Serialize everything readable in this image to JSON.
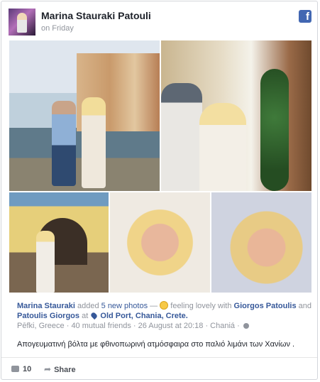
{
  "post": {
    "author": "Marina Stauraki Patouli",
    "timestamp": "on Friday",
    "brand_icon": "facebook-icon"
  },
  "photos": [
    {
      "name": "photo-harbor-couple"
    },
    {
      "name": "photo-street-selfie"
    },
    {
      "name": "photo-shop-doorway"
    },
    {
      "name": "photo-selfie-1"
    },
    {
      "name": "photo-selfie-2"
    }
  ],
  "caption": {
    "actor": "Marina Stauraki",
    "added_text": "added",
    "photos_link": "5 new photos",
    "dash": "—",
    "feeling_text": "feeling lovely with",
    "person1": "Giorgos Patoulis",
    "and_text": "and",
    "person2": "Patoulis Giorgos",
    "at_text": "at",
    "location": "Old Port, Chania, Crete.",
    "meta_place": "Pēfki, Greece",
    "mutual": "40 mutual friends",
    "date": "26 August at 20:18",
    "meta_city": "Chaniá",
    "sep": "·"
  },
  "description": "Απογευματινή βόλτα με φθινοπωρινή ατμόσφαιρα στο παλιό λιμάνι των Χανίων .",
  "footer": {
    "comments_count": "10",
    "share_label": "Share"
  }
}
